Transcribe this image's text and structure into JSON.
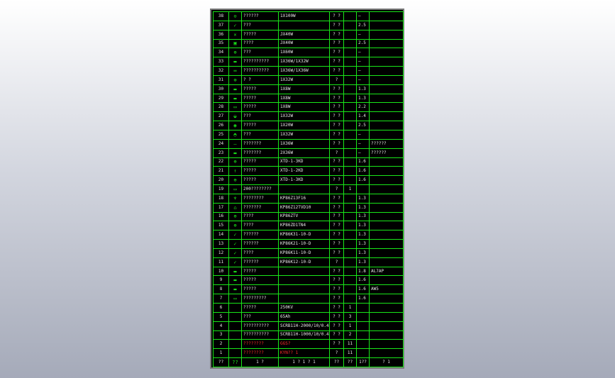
{
  "table": {
    "header": {
      "num": "??",
      "sym": "??",
      "name": "1  ?",
      "model": "1 ? 1 ? 1",
      "a": "??",
      "b": "??",
      "c": "1??",
      "d": "?    1"
    },
    "rows": [
      {
        "num": "38",
        "icon": "circle-dot-icon",
        "sym": "⊙",
        "name": "??????",
        "model": "1X100W",
        "a": "? ?",
        "b": "",
        "c": "—",
        "d": ""
      },
      {
        "num": "37",
        "icon": "check-mark-icon",
        "sym": "✓",
        "name": "???",
        "model": "",
        "a": "? ?",
        "b": "",
        "c": "2.5",
        "d": ""
      },
      {
        "num": "36",
        "icon": "cross-icon",
        "sym": "✕",
        "name": "?????",
        "model": "JX40W",
        "a": "? ?",
        "b": "",
        "c": "—",
        "d": ""
      },
      {
        "num": "35",
        "icon": "square-icon",
        "sym": "▣",
        "name": "????",
        "model": "JX40W",
        "a": "? ?",
        "b": "",
        "c": "2.5",
        "d": ""
      },
      {
        "num": "34",
        "icon": "circle-icon",
        "sym": "⊕",
        "name": "???",
        "model": "1X60W",
        "a": "? ?",
        "b": "",
        "c": "—",
        "d": ""
      },
      {
        "num": "33",
        "icon": "double-lamp-icon",
        "sym": "▬",
        "name": "??????????",
        "model": "1X36W/1X32W",
        "a": "? ?",
        "b": "",
        "c": "—",
        "d": ""
      },
      {
        "num": "32",
        "icon": "double-line-icon",
        "sym": "═",
        "name": "??????????",
        "model": "1X36W/1X36W",
        "a": "? ?",
        "b": "",
        "c": "—",
        "d": ""
      },
      {
        "num": "31",
        "icon": "circle-cross-icon",
        "sym": "⊗",
        "name": "?  ?",
        "model": "1X32W",
        "a": "?",
        "b": "",
        "c": "—",
        "d": ""
      },
      {
        "num": "30",
        "icon": "bar-icon",
        "sym": "▬",
        "name": "?????",
        "model": "1X8W",
        "a": "? ?",
        "b": "",
        "c": "1.3",
        "d": ""
      },
      {
        "num": "29",
        "icon": "bar-icon",
        "sym": "▬",
        "name": "?????",
        "model": "1X8W",
        "a": "? ?",
        "b": "",
        "c": "1.3",
        "d": ""
      },
      {
        "num": "28",
        "icon": "rounded-rect-icon",
        "sym": "▭",
        "name": "?????",
        "model": "1X8W",
        "a": "? ?",
        "b": "",
        "c": "2.2",
        "d": ""
      },
      {
        "num": "27",
        "icon": "circle-half-icon",
        "sym": "◒",
        "name": "???",
        "model": "1X32W",
        "a": "? ?",
        "b": "",
        "c": "1.4",
        "d": ""
      },
      {
        "num": "26",
        "icon": "circle-filled-icon",
        "sym": "◉",
        "name": "?????",
        "model": "1X20W",
        "a": "? ?",
        "b": "",
        "c": "2.5",
        "d": ""
      },
      {
        "num": "25",
        "icon": "half-circle-icon",
        "sym": "◓",
        "name": "???",
        "model": "1X32W",
        "a": "? ?",
        "b": "",
        "c": "—",
        "d": ""
      },
      {
        "num": "24",
        "icon": "thin-line-icon",
        "sym": "—",
        "name": "???????",
        "model": "1X36W",
        "a": "? ?",
        "b": "",
        "c": "—",
        "d": "??????"
      },
      {
        "num": "23",
        "icon": "thick-line-icon",
        "sym": "▬",
        "name": "???????",
        "model": "2X36W",
        "a": "?",
        "b": "",
        "c": "—",
        "d": "??????"
      },
      {
        "num": "22",
        "icon": "arrow-up-cross-icon",
        "sym": "⊕",
        "name": "?????",
        "model": "XTD-1-3KD",
        "a": "? ?",
        "b": "",
        "c": "1.6",
        "d": ""
      },
      {
        "num": "21",
        "icon": "arrow-up-icon",
        "sym": "↑",
        "name": "?????",
        "model": "XTD-1-2KD",
        "a": "? ?",
        "b": "",
        "c": "1.6",
        "d": ""
      },
      {
        "num": "20",
        "icon": "arrow-up-dot-icon",
        "sym": "⊕",
        "name": "?????",
        "model": "XTD-1-3KD",
        "a": "? ?",
        "b": "",
        "c": "1.6",
        "d": ""
      },
      {
        "num": "19",
        "icon": "box-icon",
        "sym": "▭",
        "name": "200????????",
        "model": "",
        "a": "?",
        "b": "1",
        "c": "",
        "d": ""
      },
      {
        "num": "18",
        "icon": "socket-icon",
        "sym": "♆",
        "name": "????????",
        "model": "KP86Z13F16",
        "a": "? ?",
        "b": "",
        "c": "1.3",
        "d": ""
      },
      {
        "num": "17",
        "icon": "socket-pair-icon",
        "sym": "⌂",
        "name": "???????",
        "model": "KP86Z12TVD10",
        "a": "? ?",
        "b": "",
        "c": "1.3",
        "d": ""
      },
      {
        "num": "16",
        "icon": "tv-socket-icon",
        "sym": "⊕",
        "name": "????",
        "model": "KP86ZTV",
        "a": "? ?",
        "b": "",
        "c": "1.3",
        "d": ""
      },
      {
        "num": "15",
        "icon": "phone-socket-icon",
        "sym": "⊕",
        "name": "????",
        "model": "KP86ZD1TN4",
        "a": "? ?",
        "b": "",
        "c": "1.3",
        "d": ""
      },
      {
        "num": "14",
        "icon": "switch-icon",
        "sym": "✓",
        "name": "??????",
        "model": "KP86K31-10-D",
        "a": "? ?",
        "b": "",
        "c": "1.3",
        "d": ""
      },
      {
        "num": "13",
        "icon": "switch-icon",
        "sym": "✓",
        "name": "??????",
        "model": "KP86K21-10-D",
        "a": "? ?",
        "b": "",
        "c": "1.3",
        "d": ""
      },
      {
        "num": "12",
        "icon": "switch-icon",
        "sym": "✓",
        "name": "????",
        "model": "KP86K11-10-D",
        "a": "? ?",
        "b": "",
        "c": "1.3",
        "d": ""
      },
      {
        "num": "11",
        "icon": "two-way-switch-icon",
        "sym": "✓",
        "name": "??????",
        "model": "KP86K12-10-D",
        "a": "?",
        "b": "",
        "c": "1.3",
        "d": ""
      },
      {
        "num": "10",
        "icon": "panel-icon",
        "sym": "▬",
        "name": "?????",
        "model": "",
        "a": "? ?",
        "b": "",
        "c": "1.8",
        "d": "AL7AP"
      },
      {
        "num": "9",
        "icon": "panel-icon",
        "sym": "▬",
        "name": "?????",
        "model": "",
        "a": "? ?",
        "b": "",
        "c": "1.6",
        "d": ""
      },
      {
        "num": "8",
        "icon": "panel-icon",
        "sym": "▬",
        "name": "?????",
        "model": "",
        "a": "? ?",
        "b": "",
        "c": "1.6",
        "d": "AW5"
      },
      {
        "num": "7",
        "icon": "meter-icon",
        "sym": "▭",
        "name": "?????????",
        "model": "",
        "a": "? ?",
        "b": "",
        "c": "1.6",
        "d": ""
      },
      {
        "num": "6",
        "icon": "",
        "sym": "",
        "name": "?????",
        "model": "250KV",
        "a": "? ?",
        "b": "1",
        "c": "",
        "d": ""
      },
      {
        "num": "5",
        "icon": "",
        "sym": "",
        "name": "???",
        "model": "65Ah",
        "a": "? ?",
        "b": "3",
        "c": "",
        "d": ""
      },
      {
        "num": "4",
        "icon": "",
        "sym": "",
        "name": "??????????",
        "model": "SCRB11H-2000/10/0.4KV",
        "a": "? ?",
        "b": "1",
        "c": "",
        "d": ""
      },
      {
        "num": "3",
        "icon": "",
        "sym": "",
        "name": "??????????",
        "model": "SCRB11H-1000/10/0.4KV",
        "a": "? ?",
        "b": "2",
        "c": "",
        "d": ""
      },
      {
        "num": "2",
        "icon": "",
        "sym": "",
        "name": "????????",
        "model": "GGS?",
        "a": "? ?",
        "b": "11",
        "c": "",
        "d": "",
        "red": true
      },
      {
        "num": "1",
        "icon": "",
        "sym": "",
        "name": "????????",
        "model": "KYN??  1",
        "a": "?",
        "b": "11",
        "c": "",
        "d": "",
        "red": true
      }
    ]
  }
}
